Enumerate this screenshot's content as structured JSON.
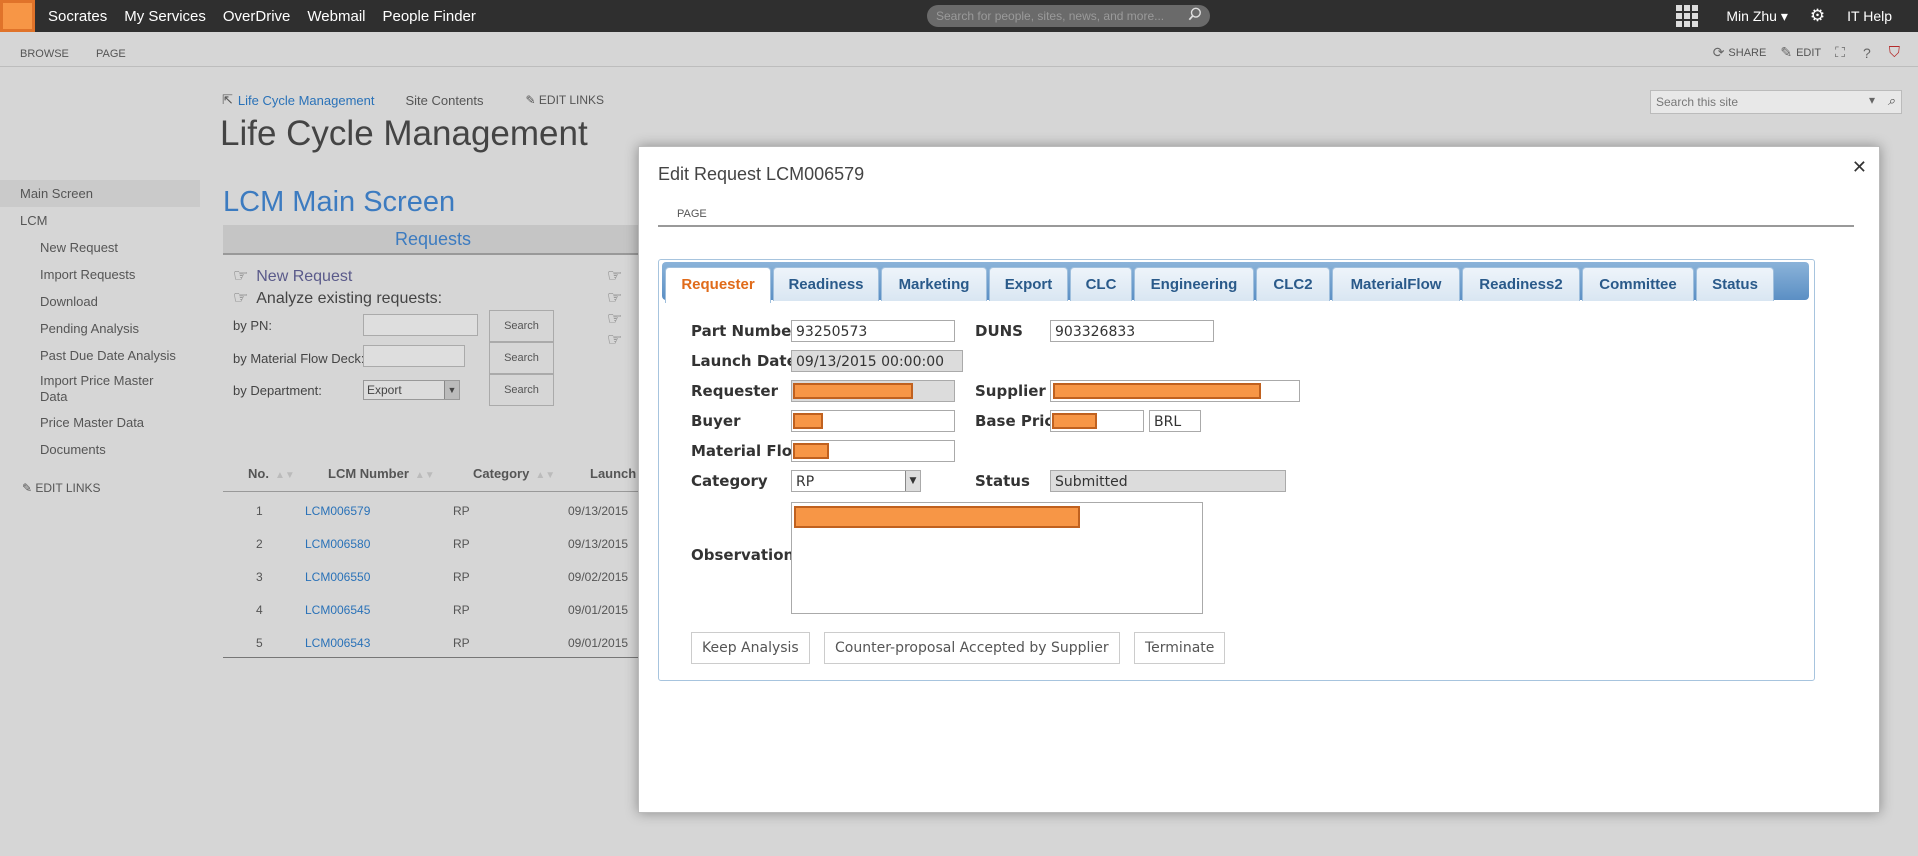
{
  "suitebar": {
    "links": [
      "Socrates",
      "My Services",
      "OverDrive",
      "Webmail",
      "People Finder"
    ],
    "search_placeholder": "Search for people, sites, news, and more...",
    "user": "Min Zhu ▾",
    "ithelp": "IT Help"
  },
  "ribbon": {
    "tab_browse": "BROWSE",
    "tab_page": "PAGE",
    "share": "SHARE",
    "edit": "EDIT"
  },
  "site": {
    "breadcrumb_home": "Life Cycle Management",
    "breadcrumb_contents": "Site Contents",
    "edit_links": "EDIT LINKS",
    "title": "Life Cycle Management",
    "search_placeholder": "Search this site"
  },
  "leftnav": {
    "main_screen": "Main Screen",
    "lcm": "LCM",
    "items": [
      "New Request",
      "Import Requests",
      "Download",
      "Pending Analysis",
      "Past Due Date Analysis",
      "Import Price Master Data",
      "Price Master Data",
      "Documents"
    ],
    "edit_links": "EDIT LINKS"
  },
  "main": {
    "heading": "LCM Main Screen",
    "requests_bar": "Requests",
    "new_request": "New Request",
    "analyze": "Analyze existing requests:",
    "by_pn": "by PN:",
    "by_flow": "by Material Flow Deck:",
    "by_dept": "by Department:",
    "dept_value": "Export",
    "search_btn": "Search"
  },
  "table": {
    "headers": [
      "No.",
      "LCM Number",
      "Category",
      "Launch"
    ],
    "rows": [
      {
        "no": "1",
        "lcm": "LCM006579",
        "cat": "RP",
        "launch": "09/13/2015"
      },
      {
        "no": "2",
        "lcm": "LCM006580",
        "cat": "RP",
        "launch": "09/13/2015"
      },
      {
        "no": "3",
        "lcm": "LCM006550",
        "cat": "RP",
        "launch": "09/02/2015"
      },
      {
        "no": "4",
        "lcm": "LCM006545",
        "cat": "RP",
        "launch": "09/01/2015"
      },
      {
        "no": "5",
        "lcm": "LCM006543",
        "cat": "RP",
        "launch": "09/01/2015"
      }
    ]
  },
  "modal": {
    "title": "Edit Request LCM006579",
    "ribbon_page": "PAGE",
    "tabs": [
      "Requester",
      "Readiness",
      "Marketing",
      "Export",
      "CLC",
      "Engineering",
      "CLC2",
      "MaterialFlow",
      "Readiness2",
      "Committee",
      "Status"
    ],
    "labels": {
      "part_number": "Part Number",
      "duns": "DUNS",
      "launch_date": "Launch Date",
      "requester": "Requester",
      "supplier": "Supplier",
      "buyer": "Buyer",
      "base_price": "Base Price",
      "material_flow": "Material Flow",
      "category": "Category",
      "status": "Status",
      "observation": "Observation"
    },
    "values": {
      "part_number": "93250573",
      "duns": "903326833",
      "launch_date": "09/13/2015 00:00:00",
      "currency": "BRL",
      "category": "RP",
      "status": "Submitted"
    },
    "buttons": {
      "keep": "Keep Analysis",
      "counter": "Counter-proposal Accepted by Supplier",
      "terminate": "Terminate"
    }
  },
  "colors": {
    "accent_orange": "#f79646",
    "link_blue": "#2a72b8",
    "tab_active": "#e06b1a"
  }
}
